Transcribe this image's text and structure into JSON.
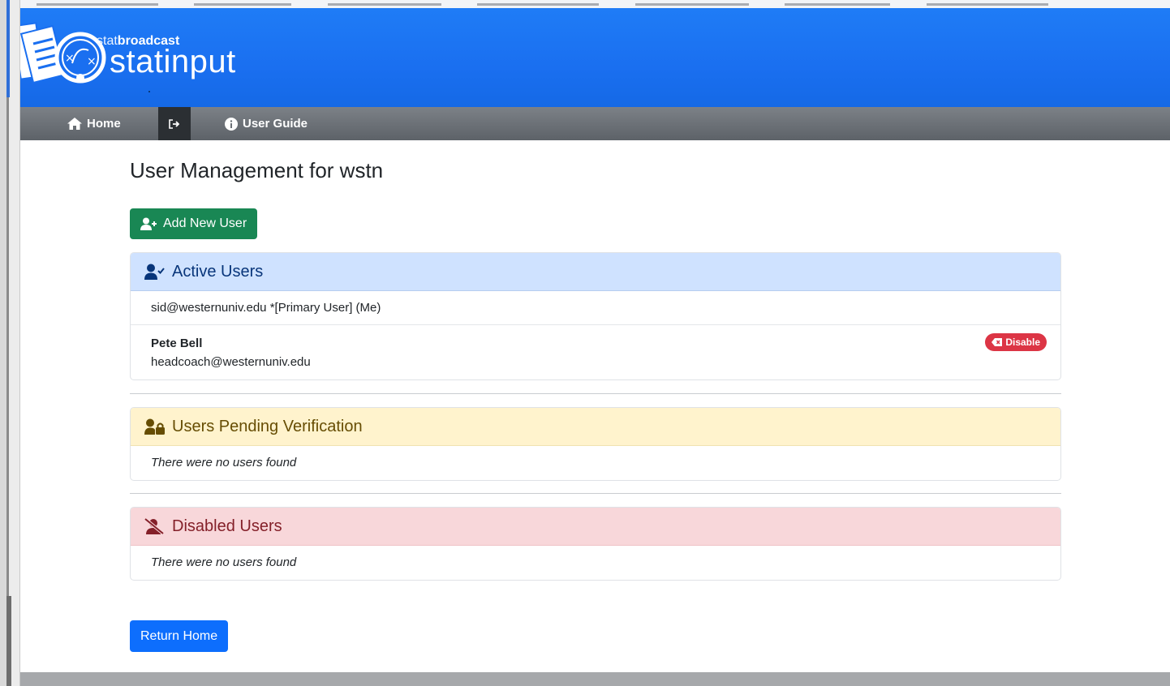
{
  "brand": {
    "small_prefix": "stat",
    "small_bold": "broadcast",
    "name": "statinput"
  },
  "nav": {
    "home_label": "Home",
    "guide_label": "User Guide"
  },
  "page": {
    "title": "User Management for wstn",
    "add_user_label": "Add New User",
    "return_label": "Return Home"
  },
  "active_users": {
    "title": "Active Users",
    "primary_row": "sid@westernuniv.edu *[Primary User] (Me)",
    "users": [
      {
        "name": "Pete Bell",
        "email": "headcoach@westernuniv.edu",
        "action_label": "Disable"
      }
    ]
  },
  "pending_users": {
    "title": "Users Pending Verification",
    "empty_text": "There were no users found"
  },
  "disabled_users": {
    "title": "Disabled Users",
    "empty_text": "There were no users found"
  },
  "colors": {
    "header_blue": "#1a6ff0",
    "nav_gray": "#6c7177",
    "success": "#198754",
    "primary": "#0d6efd",
    "danger": "#dc3545"
  }
}
